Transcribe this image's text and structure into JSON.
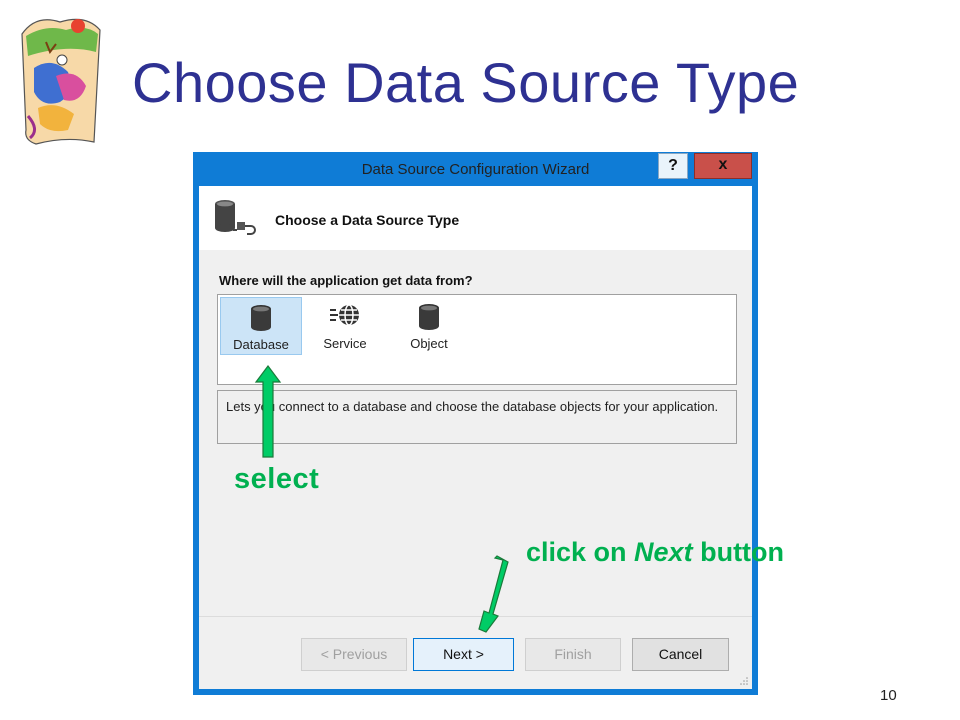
{
  "slide": {
    "title": "Choose Data Source Type",
    "page_number": "10"
  },
  "wizard": {
    "window_title": "Data Source Configuration Wizard",
    "help_label": "?",
    "close_label": "x",
    "header_title": "Choose a Data Source Type",
    "question": "Where will the application get data from?",
    "types": [
      {
        "label": "Database",
        "icon": "database-icon",
        "selected": true
      },
      {
        "label": "Service",
        "icon": "service-globe-icon",
        "selected": false
      },
      {
        "label": "Object",
        "icon": "object-cylinder-icon",
        "selected": false
      }
    ],
    "description": "Lets you connect to a database and choose the database objects for your application.",
    "buttons": {
      "previous": "< Previous",
      "next": "Next >",
      "finish": "Finish",
      "cancel": "Cancel"
    }
  },
  "annotations": {
    "select": "select",
    "click_prefix": "click on ",
    "click_em": "Next",
    "click_suffix": " button",
    "arrow_color": "#00cc66"
  },
  "colors": {
    "title": "#2e3192",
    "annotation_text": "#00b050",
    "window_frame": "#0f7cd6",
    "close_button": "#c9504a",
    "selected_item": "#cce4f7"
  }
}
